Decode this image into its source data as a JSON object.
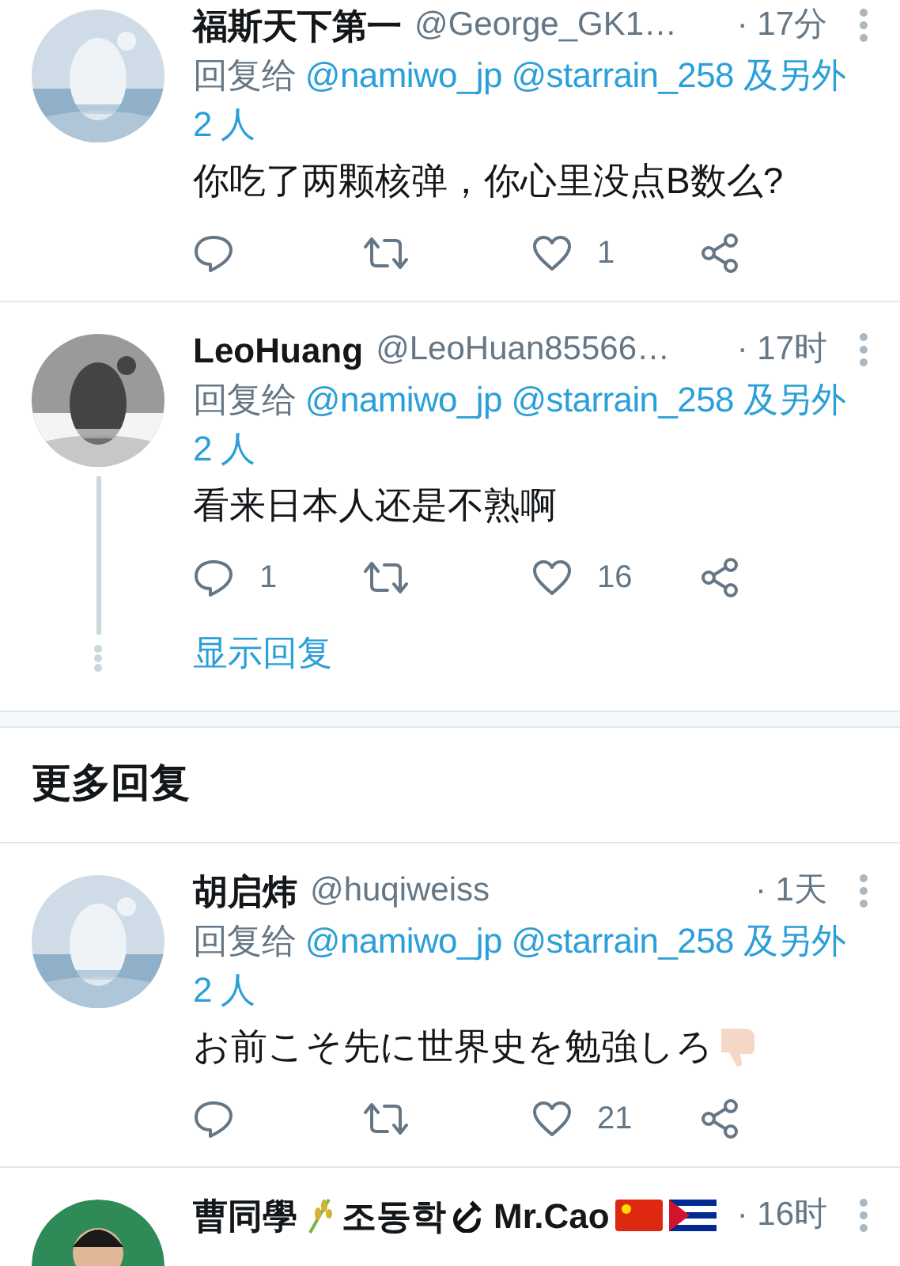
{
  "tweets": [
    {
      "name_parts": [
        {
          "kind": "text",
          "text": "福斯天下第一"
        }
      ],
      "handle": "@George_GK1…",
      "time": "· 17分",
      "reply_prefix": "回复给",
      "mentions": [
        "@namiwo_jp",
        "@starrain_258"
      ],
      "reply_suffix": "及另外 2 人",
      "body": "你吃了两颗核弹，你心里没点B数么?",
      "actions": {
        "likes": "1"
      },
      "avatar": {
        "kind": "picture"
      }
    },
    {
      "name_parts": [
        {
          "kind": "text",
          "text": "LeoHuang"
        }
      ],
      "handle": "@LeoHuan85566…",
      "time": "· 17时",
      "reply_prefix": "回复给",
      "mentions": [
        "@namiwo_jp",
        "@starrain_258"
      ],
      "reply_suffix": "及另外 2 人",
      "body": "看来日本人还是不熟啊",
      "actions": {
        "replies": "1",
        "likes": "16"
      },
      "show_replies": "显示回复",
      "avatar": {
        "kind": "picture"
      }
    }
  ],
  "section_title": "更多回复",
  "more_tweets": [
    {
      "name_parts": [
        {
          "kind": "text",
          "text": "胡启炜"
        }
      ],
      "handle": "@huqiweiss",
      "time": "· 1天",
      "reply_prefix": "回复给",
      "mentions": [
        "@namiwo_jp",
        "@starrain_258"
      ],
      "reply_suffix": "及另外 2 人",
      "body": "お前こそ先に世界史を勉強しろ",
      "trailing_icon": {
        "kind": "thumbs_down"
      },
      "actions": {
        "likes": "21"
      },
      "avatar": {
        "kind": "picture"
      }
    },
    {
      "name_parts": [
        {
          "kind": "text",
          "text": "曹同學"
        },
        {
          "kind": "plant"
        },
        {
          "kind": "text",
          "text": "조동학"
        },
        {
          "kind": "sickle"
        },
        {
          "kind": "text",
          "text": "Mr.Cao"
        },
        {
          "kind": "flag_cn"
        },
        {
          "kind": "flag_cu"
        }
      ],
      "time": "· 16时",
      "avatar": {
        "kind": "person"
      }
    }
  ]
}
